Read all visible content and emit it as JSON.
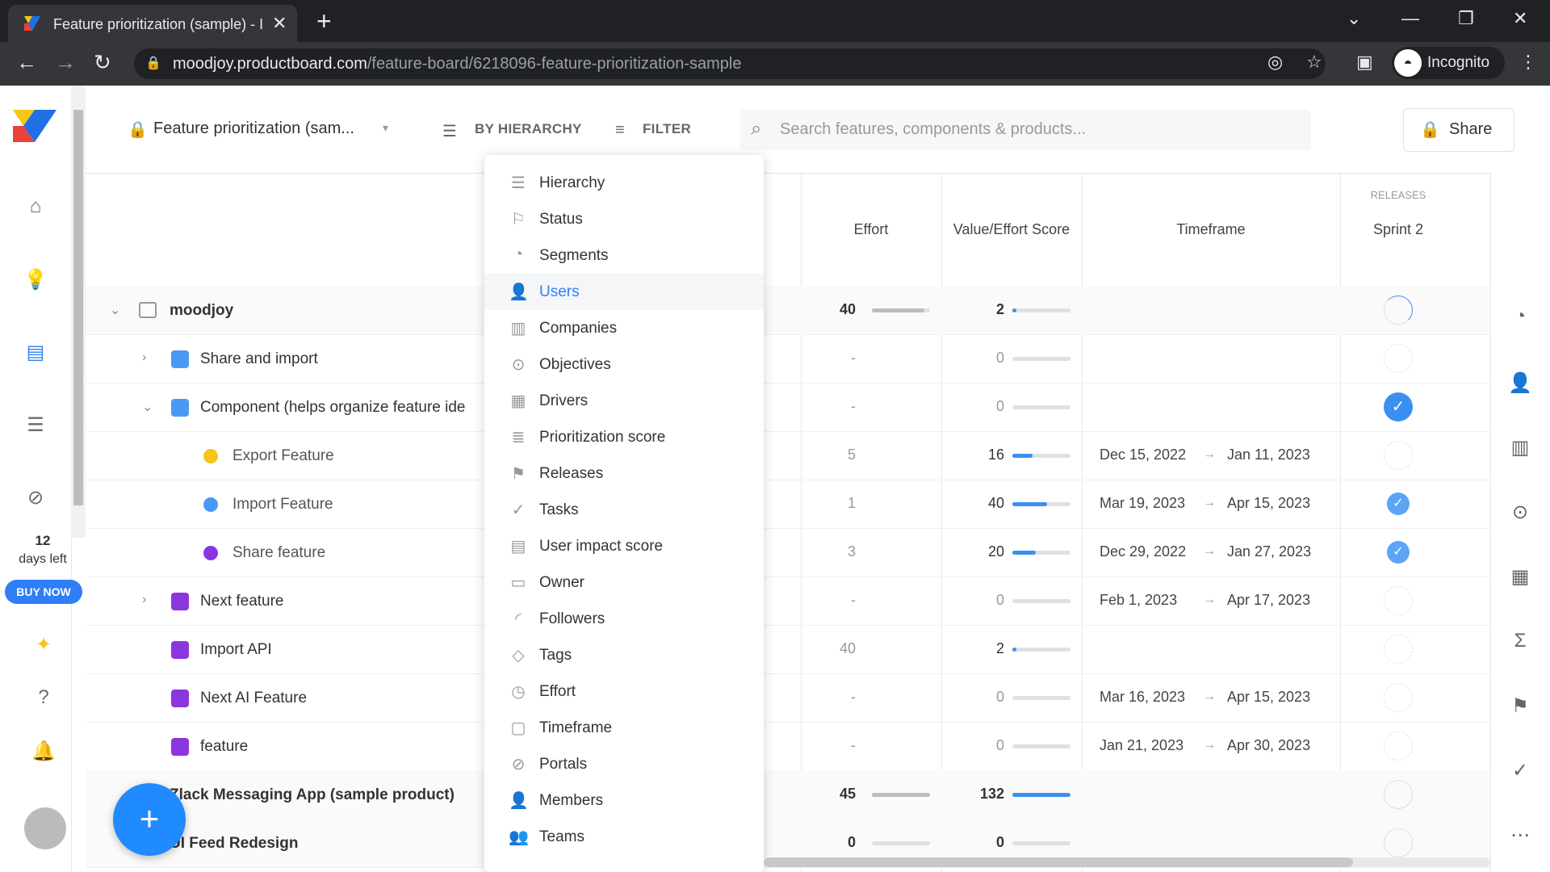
{
  "browser": {
    "tab_title": "Feature prioritization (sample) - I",
    "url_domain": "moodjoy.productboard.com",
    "url_path": "/feature-board/6218096-feature-prioritization-sample",
    "incognito_label": "Incognito"
  },
  "sidebar": {
    "trial_days": "12",
    "trial_label": "days left",
    "buy_now": "BUY NOW"
  },
  "header": {
    "board_title": "Feature prioritization (sam...",
    "group_by": "BY HIERARCHY",
    "filter": "FILTER",
    "search_placeholder": "Search features, components & products...",
    "share": "Share"
  },
  "columns": {
    "effort": "Effort",
    "value_effort": "Value/Effort Score",
    "timeframe": "Timeframe",
    "releases_group": "RELEASES",
    "sprint": "Sprint 2"
  },
  "dropdown": {
    "items": [
      {
        "label": "Hierarchy",
        "icon": "hierarchy-icon"
      },
      {
        "label": "Status",
        "icon": "bookmark-icon"
      },
      {
        "label": "Segments",
        "icon": "pie-icon"
      },
      {
        "label": "Users",
        "icon": "user-icon"
      },
      {
        "label": "Companies",
        "icon": "building-icon"
      },
      {
        "label": "Objectives",
        "icon": "target-icon"
      },
      {
        "label": "Drivers",
        "icon": "grid-icon"
      },
      {
        "label": "Prioritization score",
        "icon": "score-icon"
      },
      {
        "label": "Releases",
        "icon": "flag-icon"
      },
      {
        "label": "Tasks",
        "icon": "check-circle-icon"
      },
      {
        "label": "User impact score",
        "icon": "clipboard-icon"
      },
      {
        "label": "Owner",
        "icon": "briefcase-icon"
      },
      {
        "label": "Followers",
        "icon": "signal-icon"
      },
      {
        "label": "Tags",
        "icon": "tag-icon"
      },
      {
        "label": "Effort",
        "icon": "clock-icon"
      },
      {
        "label": "Timeframe",
        "icon": "calendar-icon"
      },
      {
        "label": "Portals",
        "icon": "portal-icon"
      },
      {
        "label": "Members",
        "icon": "member-icon"
      },
      {
        "label": "Teams",
        "icon": "team-icon"
      }
    ],
    "active": "Users"
  },
  "rows": [
    {
      "label": "moodjoy",
      "effort": "40",
      "score": "2",
      "score_fill": 0.05,
      "effort_fill": 0.9,
      "start": "",
      "end": "",
      "sprint": "loading"
    },
    {
      "label": "Share and import",
      "effort": "-",
      "score": "0",
      "start": "",
      "end": "",
      "sprint": "empty"
    },
    {
      "label": "Component (helps organize feature ide",
      "effort": "-",
      "score": "0",
      "start": "",
      "end": "",
      "sprint": "check"
    },
    {
      "label": "Export Feature",
      "effort": "5",
      "score": "16",
      "score_fill": 0.35,
      "start": "Dec 15, 2022",
      "end": "Jan 11, 2023",
      "sprint": "empty"
    },
    {
      "label": "Import Feature",
      "effort": "1",
      "score": "40",
      "score_fill": 0.6,
      "start": "Mar 19, 2023",
      "end": "Apr 15, 2023",
      "sprint": "check-small"
    },
    {
      "label": "Share feature",
      "effort": "3",
      "score": "20",
      "score_fill": 0.4,
      "start": "Dec 29, 2022",
      "end": "Jan 27, 2023",
      "sprint": "check-small"
    },
    {
      "label": "Next feature",
      "effort": "-",
      "score": "0",
      "start": "Feb 1, 2023",
      "end": "Apr 17, 2023",
      "sprint": "empty"
    },
    {
      "label": "Import API",
      "effort": "40",
      "score": "2",
      "score_fill": 0.05,
      "start": "",
      "end": "",
      "sprint": "empty"
    },
    {
      "label": "Next AI Feature",
      "effort": "-",
      "score": "0",
      "start": "Mar 16, 2023",
      "end": "Apr 15, 2023",
      "sprint": "empty"
    },
    {
      "label": "feature",
      "effort": "-",
      "score": "0",
      "start": "Jan 21, 2023",
      "end": "Apr 30, 2023",
      "sprint": "empty"
    },
    {
      "label": "Zlack Messaging App (sample product)",
      "effort": "45",
      "score": "132",
      "score_fill": 1.0,
      "effort_fill": 1.0,
      "start": "",
      "end": "",
      "sprint": "empty"
    },
    {
      "label": "UI Feed Redesign",
      "effort": "0",
      "score": "0",
      "start": "",
      "end": "",
      "sprint": "empty"
    }
  ],
  "colors": {
    "accent": "#2f7ef6",
    "component": "#4a9af5",
    "feature_purple": "#8b35e0",
    "feature_yellow": "#f5c518"
  }
}
